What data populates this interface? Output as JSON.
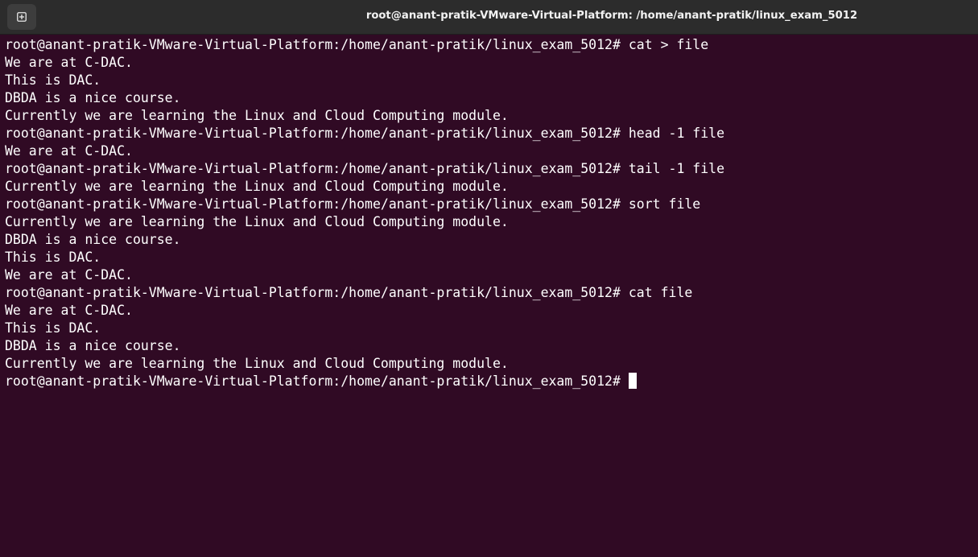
{
  "window": {
    "title": "root@anant-pratik-VMware-Virtual-Platform: /home/anant-pratik/linux_exam_5012"
  },
  "terminal": {
    "lines": [
      "root@anant-pratik-VMware-Virtual-Platform:/home/anant-pratik/linux_exam_5012# cat > file",
      "We are at C-DAC.",
      "This is DAC.",
      "DBDA is a nice course.",
      "Currently we are learning the Linux and Cloud Computing module.",
      "root@anant-pratik-VMware-Virtual-Platform:/home/anant-pratik/linux_exam_5012# head -1 file",
      "We are at C-DAC.",
      "root@anant-pratik-VMware-Virtual-Platform:/home/anant-pratik/linux_exam_5012# tail -1 file",
      "Currently we are learning the Linux and Cloud Computing module.",
      "root@anant-pratik-VMware-Virtual-Platform:/home/anant-pratik/linux_exam_5012# sort file",
      "Currently we are learning the Linux and Cloud Computing module.",
      "DBDA is a nice course.",
      "This is DAC.",
      "We are at C-DAC.",
      "root@anant-pratik-VMware-Virtual-Platform:/home/anant-pratik/linux_exam_5012# cat file",
      "We are at C-DAC.",
      "This is DAC.",
      "DBDA is a nice course.",
      "Currently we are learning the Linux and Cloud Computing module."
    ],
    "prompt": "root@anant-pratik-VMware-Virtual-Platform:/home/anant-pratik/linux_exam_5012#"
  },
  "colors": {
    "background": "#300a24",
    "foreground": "#ffffff",
    "titlebar": "#2c2c2c"
  },
  "icons": {
    "new_tab": "new-tab-icon"
  }
}
